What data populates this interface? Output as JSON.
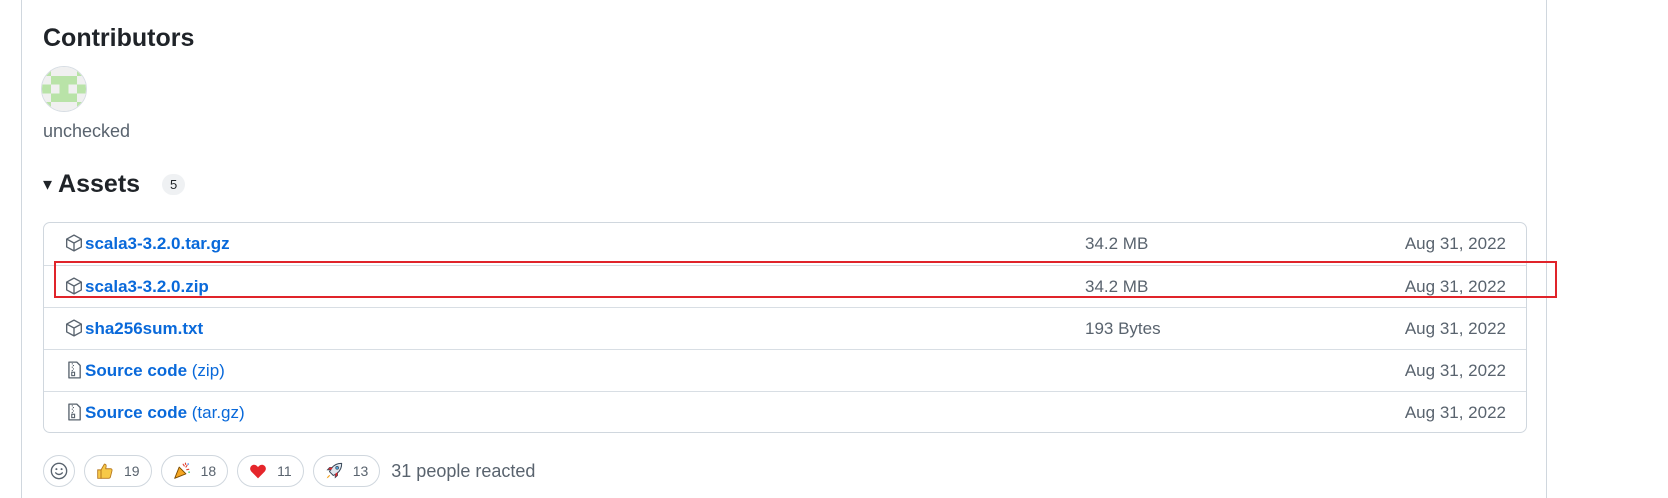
{
  "contributors": {
    "title": "Contributors",
    "users": [
      {
        "name": "unchecked",
        "avatar": "identicon-green"
      }
    ]
  },
  "assets": {
    "title": "Assets",
    "count": "5",
    "items": [
      {
        "name": "scala3-3.2.0.tar.gz",
        "sub": "",
        "size": "34.2 MB",
        "date": "Aug 31, 2022",
        "icon": "package-icon"
      },
      {
        "name": "scala3-3.2.0.zip",
        "sub": "",
        "size": "34.2 MB",
        "date": "Aug 31, 2022",
        "icon": "package-icon"
      },
      {
        "name": "sha256sum.txt",
        "sub": "",
        "size": "193 Bytes",
        "date": "Aug 31, 2022",
        "icon": "package-icon"
      },
      {
        "name": "Source code",
        "sub": " (zip)",
        "size": "",
        "date": "Aug 31, 2022",
        "icon": "file-zip-icon"
      },
      {
        "name": "Source code",
        "sub": " (tar.gz)",
        "size": "",
        "date": "Aug 31, 2022",
        "icon": "file-zip-icon"
      }
    ],
    "highlighted_index": 1,
    "highlight_color": "#e0242a"
  },
  "reactions": {
    "items": [
      {
        "emoji": "thumbs-up",
        "count": "19"
      },
      {
        "emoji": "hooray",
        "count": "18"
      },
      {
        "emoji": "heart",
        "count": "11"
      },
      {
        "emoji": "rocket",
        "count": "13"
      }
    ],
    "summary": "31 people reacted"
  },
  "colors": {
    "link": "#0969da",
    "muted": "#59636e",
    "border": "#d0d7de"
  }
}
